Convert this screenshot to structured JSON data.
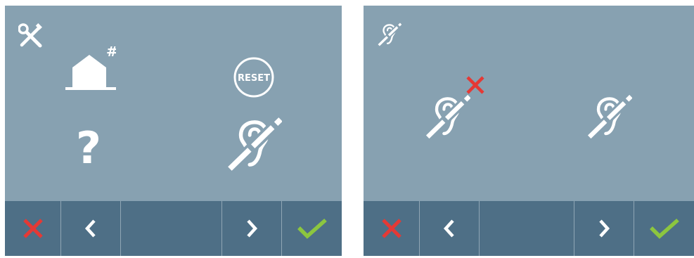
{
  "left_screen": {
    "menu": {
      "settings_icon": "tools-icon",
      "address_icon": "house-hash-icon",
      "address_symbol": "#",
      "reset_icon": "reset-icon",
      "reset_label": "RESET",
      "help_icon": "question-icon",
      "help_symbol": "?",
      "hearing_loop_icon": "hearing-loop-icon"
    },
    "toolbar": [
      "cancel-icon",
      "chevron-left-icon",
      "",
      "chevron-right-icon",
      "check-icon"
    ]
  },
  "right_screen": {
    "header_icon": "hearing-loop-icon",
    "options": [
      {
        "icon": "hearing-loop-icon",
        "state": "off",
        "badge": "red-x"
      },
      {
        "icon": "hearing-loop-icon",
        "state": "on"
      }
    ],
    "toolbar": [
      "cancel-icon",
      "chevron-left-icon",
      "",
      "chevron-right-icon",
      "check-icon"
    ]
  },
  "colors": {
    "screen_bg": "#87a1b1",
    "toolbar_bg": "#4e6f86",
    "cancel": "#e53935",
    "confirm": "#8cc63f",
    "icon": "#ffffff"
  }
}
